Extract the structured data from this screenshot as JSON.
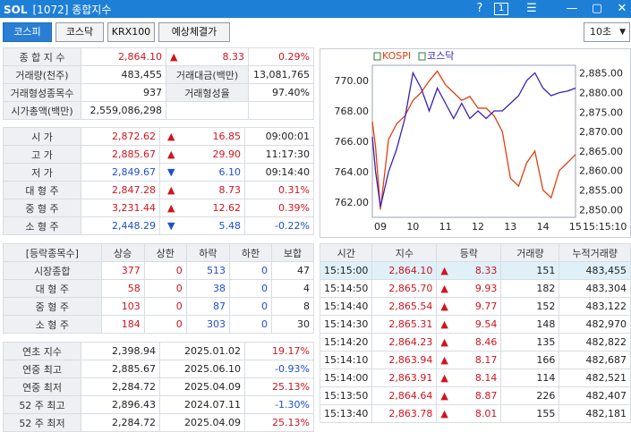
{
  "title": "[1072] 종합지수",
  "logo": "SOL",
  "titlebar_buttons": [
    "?",
    "1",
    "☰",
    "—",
    "▢",
    "✕"
  ],
  "tabs": [
    "코스피",
    "코스닥",
    "KRX100",
    "예상체결가"
  ],
  "interval": "10초",
  "summary": {
    "rows": [
      {
        "l1": "종 합 지 수",
        "v1": "2,864.10",
        "mark": "▲",
        "v2": "8.33",
        "v3": "0.29%"
      },
      {
        "l1": "거래량(천주)",
        "v1": "483,455",
        "l2": "거래대금(백만)",
        "v2": "13,081,765"
      },
      {
        "l1": "거래형성종목수",
        "v1": "937",
        "l2": "거래형성율",
        "v2": "97.40%"
      },
      {
        "l1": "시가총액(백만)",
        "v1": "2,559,086,298"
      }
    ]
  },
  "prices": [
    {
      "label": "시       가",
      "value": "2,872.62",
      "mark": "▲",
      "change": "16.85",
      "extra": "09:00:01",
      "dir": "up"
    },
    {
      "label": "고       가",
      "value": "2,885.67",
      "mark": "▲",
      "change": "29.90",
      "extra": "11:17:30",
      "dir": "up"
    },
    {
      "label": "저       가",
      "value": "2,849.67",
      "mark": "▼",
      "change": "6.10",
      "extra": "09:14:40",
      "dir": "dn"
    },
    {
      "label": "대 형 주",
      "value": "2,847.28",
      "mark": "▲",
      "change": "8.73",
      "extra": "0.31%",
      "dir": "up"
    },
    {
      "label": "중 형 주",
      "value": "3,231.44",
      "mark": "▲",
      "change": "12.62",
      "extra": "0.39%",
      "dir": "up"
    },
    {
      "label": "소 형 주",
      "value": "2,448.29",
      "mark": "▼",
      "change": "5.48",
      "extra": "-0.22%",
      "dir": "dn"
    }
  ],
  "breadth": {
    "headers": [
      "[등락종목수]",
      "상승",
      "상한",
      "하락",
      "하한",
      "보합"
    ],
    "rows": [
      {
        "label": "시장종합",
        "v": [
          "377",
          "0",
          "513",
          "0",
          "47"
        ]
      },
      {
        "label": "대 형 주",
        "v": [
          "58",
          "0",
          "38",
          "0",
          "4"
        ]
      },
      {
        "label": "중 형 주",
        "v": [
          "103",
          "0",
          "87",
          "0",
          "8"
        ]
      },
      {
        "label": "소 형 주",
        "v": [
          "184",
          "0",
          "303",
          "0",
          "30"
        ]
      }
    ]
  },
  "yearly": [
    {
      "label": "연초  지수",
      "value": "2,398.94",
      "date": "2025.01.02",
      "pct": "19.17%",
      "dir": "up"
    },
    {
      "label": "연중  최고",
      "value": "2,885.67",
      "date": "2025.06.10",
      "pct": "-0.93%",
      "dir": "dn"
    },
    {
      "label": "연중  최저",
      "value": "2,284.72",
      "date": "2025.04.09",
      "pct": "25.13%",
      "dir": "up"
    },
    {
      "label": "52 주 최고",
      "value": "2,896.43",
      "date": "2024.07.11",
      "pct": "-1.30%",
      "dir": "dn"
    },
    {
      "label": "52 주 최저",
      "value": "2,284.72",
      "date": "2025.04.09",
      "pct": "25.13%",
      "dir": "up"
    }
  ],
  "ticks": {
    "headers": [
      "시간",
      "지수",
      "등락",
      "거래량",
      "누적거래량"
    ],
    "rows": [
      {
        "time": "15:15:00",
        "idx": "2,864.10",
        "mark": "▲",
        "chg": "8.33",
        "vol": "151",
        "cum": "483,455"
      },
      {
        "time": "15:14:50",
        "idx": "2,865.70",
        "mark": "▲",
        "chg": "9.93",
        "vol": "182",
        "cum": "483,304"
      },
      {
        "time": "15:14:40",
        "idx": "2,865.54",
        "mark": "▲",
        "chg": "9.77",
        "vol": "152",
        "cum": "483,122"
      },
      {
        "time": "15:14:30",
        "idx": "2,865.31",
        "mark": "▲",
        "chg": "9.54",
        "vol": "148",
        "cum": "482,970"
      },
      {
        "time": "15:14:20",
        "idx": "2,864.23",
        "mark": "▲",
        "chg": "8.46",
        "vol": "135",
        "cum": "482,822"
      },
      {
        "time": "15:14:10",
        "idx": "2,863.94",
        "mark": "▲",
        "chg": "8.17",
        "vol": "166",
        "cum": "482,687"
      },
      {
        "time": "15:14:00",
        "idx": "2,863.91",
        "mark": "▲",
        "chg": "8.14",
        "vol": "114",
        "cum": "482,521"
      },
      {
        "time": "15:13:50",
        "idx": "2,864.64",
        "mark": "▲",
        "chg": "8.87",
        "vol": "226",
        "cum": "482,407"
      },
      {
        "time": "15:13:40",
        "idx": "2,863.78",
        "mark": "▲",
        "chg": "8.01",
        "vol": "155",
        "cum": "482,181"
      }
    ]
  },
  "chart_data": {
    "type": "line",
    "legend": [
      "KOSPI",
      "코스닥"
    ],
    "x_ticks": [
      "09",
      "10",
      "11",
      "12",
      "13",
      "14",
      "15",
      "15:15:10"
    ],
    "y_left_ticks": [
      "770.00",
      "768.00",
      "766.00",
      "764.00",
      "762.00"
    ],
    "y_right_ticks": [
      "2,885.00",
      "2,880.00",
      "2,875.00",
      "2,870.00",
      "2,865.00",
      "2,860.00",
      "2,855.00",
      "2,850.00"
    ],
    "y_left_range": [
      761,
      771
    ],
    "y_right_range": [
      2848,
      2887
    ],
    "colors": {
      "kospi": "#e0400f",
      "kosdaq": "#3a21b5"
    },
    "series": [
      {
        "name": "KOSPI",
        "axis": "right",
        "x": [
          9.0,
          9.1,
          9.25,
          9.5,
          9.75,
          10.0,
          10.25,
          10.5,
          10.75,
          11.0,
          11.25,
          11.5,
          11.75,
          12.0,
          12.25,
          12.5,
          12.75,
          13.0,
          13.25,
          13.5,
          13.75,
          14.0,
          14.25,
          14.5,
          14.75,
          15.0,
          15.25
        ],
        "values": [
          2872.6,
          2866,
          2850,
          2868,
          2872,
          2874,
          2878,
          2880,
          2883,
          2885.5,
          2882,
          2880,
          2878,
          2879,
          2876,
          2876,
          2874,
          2870,
          2858,
          2856,
          2862,
          2865,
          2855,
          2853,
          2860,
          2862,
          2864.1
        ]
      },
      {
        "name": "코스닥",
        "axis": "left",
        "x": [
          9.0,
          9.1,
          9.25,
          9.5,
          9.75,
          10.0,
          10.25,
          10.5,
          10.75,
          11.0,
          11.25,
          11.5,
          11.75,
          12.0,
          12.25,
          12.5,
          12.75,
          13.0,
          13.25,
          13.5,
          13.75,
          14.0,
          14.25,
          14.5,
          14.75,
          15.0,
          15.25
        ],
        "values": [
          766.3,
          764,
          761.7,
          764,
          765.5,
          767.5,
          770.5,
          769.5,
          768,
          769.5,
          768.5,
          767.5,
          768.5,
          767.5,
          768,
          767.5,
          768,
          768,
          768.5,
          769,
          770,
          770.5,
          769.5,
          769,
          769.2,
          769.3,
          769.5
        ]
      }
    ]
  }
}
